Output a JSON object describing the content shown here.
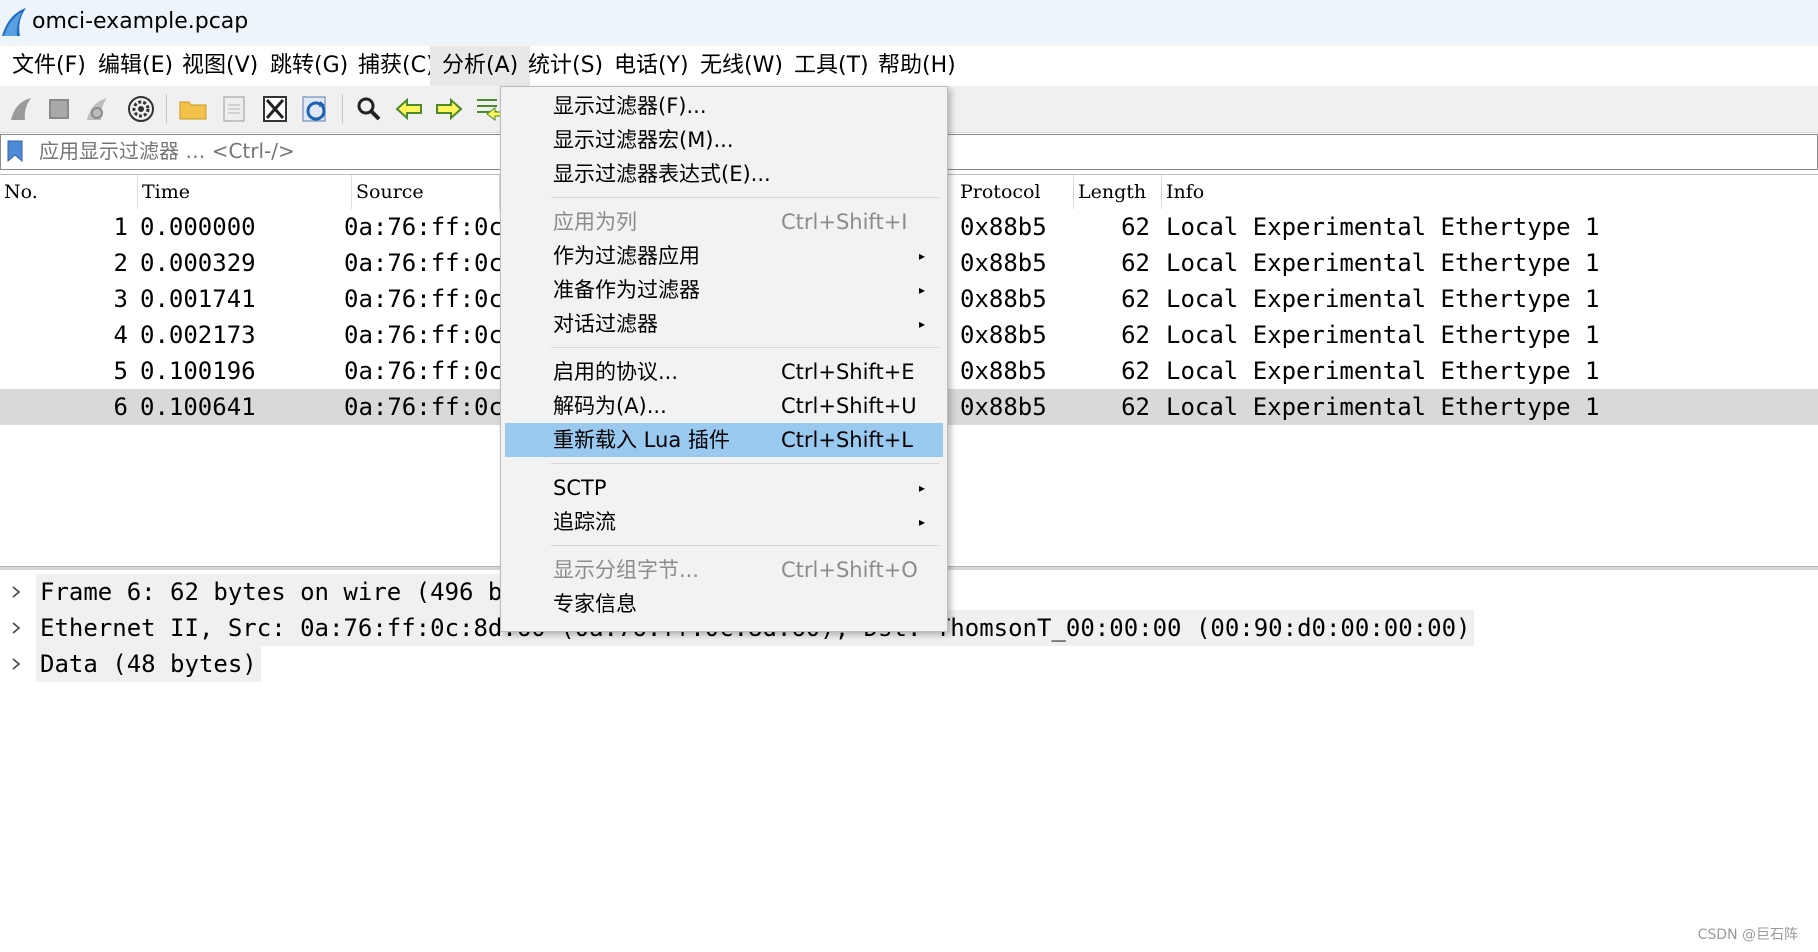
{
  "window": {
    "title": "omci-example.pcap"
  },
  "menubar": {
    "items": [
      {
        "label": "文件(F)"
      },
      {
        "label": "编辑(E)"
      },
      {
        "label": "视图(V)"
      },
      {
        "label": "跳转(G)"
      },
      {
        "label": "捕获(C)"
      },
      {
        "label": "分析(A)"
      },
      {
        "label": "统计(S)"
      },
      {
        "label": "电话(Y)"
      },
      {
        "label": "无线(W)"
      },
      {
        "label": "工具(T)"
      },
      {
        "label": "帮助(H)"
      }
    ],
    "open_menu": "分析(A)"
  },
  "toolbar": {
    "icons": [
      "shark-fin-start-icon",
      "stop-square-icon",
      "shark-fin-restart-icon",
      "gear-options-icon",
      "folder-open-icon",
      "file-save-icon",
      "close-file-icon",
      "reload-icon",
      "search-magnifier-icon",
      "arrow-back-icon",
      "arrow-forward-icon",
      "go-to-packet-icon"
    ]
  },
  "filter": {
    "placeholder": "应用显示过滤器 … <Ctrl-/>"
  },
  "packet_list": {
    "columns": [
      "No.",
      "Time",
      "Source",
      "Protocol",
      "Length",
      "Info"
    ],
    "rows": [
      {
        "no": "1",
        "time": "0.000000",
        "source": "0a:76:ff:0c",
        "protocol": "0x88b5",
        "length": "62",
        "info": "Local Experimental Ethertype 1"
      },
      {
        "no": "2",
        "time": "0.000329",
        "source": "0a:76:ff:0c",
        "protocol": "0x88b5",
        "length": "62",
        "info": "Local Experimental Ethertype 1"
      },
      {
        "no": "3",
        "time": "0.001741",
        "source": "0a:76:ff:0c",
        "protocol": "0x88b5",
        "length": "62",
        "info": "Local Experimental Ethertype 1"
      },
      {
        "no": "4",
        "time": "0.002173",
        "source": "0a:76:ff:0c",
        "protocol": "0x88b5",
        "length": "62",
        "info": "Local Experimental Ethertype 1"
      },
      {
        "no": "5",
        "time": "0.100196",
        "source": "0a:76:ff:0c",
        "protocol": "0x88b5",
        "length": "62",
        "info": "Local Experimental Ethertype 1"
      },
      {
        "no": "6",
        "time": "0.100641",
        "source": "0a:76:ff:0c",
        "protocol": "0x88b5",
        "length": "62",
        "info": "Local Experimental Ethertype 1"
      }
    ],
    "selected_row": "6"
  },
  "details": {
    "rows": [
      {
        "text": "Frame 6: 62 bytes on wire (496 b                              bits)"
      },
      {
        "text": "Ethernet II, Src: 0a:76:ff:0c:8d:60 (0a:76:ff:0c:8d:60), Dst: ThomsonT_00:00:00 (00:90:d0:00:00:00)"
      },
      {
        "text": "Data (48 bytes)"
      }
    ]
  },
  "dropdown": {
    "groups": [
      [
        {
          "label": "显示过滤器(F)...",
          "shortcut": "",
          "submenu": false,
          "disabled": false
        },
        {
          "label": "显示过滤器宏(M)...",
          "shortcut": "",
          "submenu": false,
          "disabled": false
        },
        {
          "label": "显示过滤器表达式(E)...",
          "shortcut": "",
          "submenu": false,
          "disabled": false
        }
      ],
      [
        {
          "label": "应用为列",
          "shortcut": "Ctrl+Shift+I",
          "submenu": false,
          "disabled": true
        },
        {
          "label": "作为过滤器应用",
          "shortcut": "",
          "submenu": true,
          "disabled": false
        },
        {
          "label": "准备作为过滤器",
          "shortcut": "",
          "submenu": true,
          "disabled": false
        },
        {
          "label": "对话过滤器",
          "shortcut": "",
          "submenu": true,
          "disabled": false
        }
      ],
      [
        {
          "label": "启用的协议...",
          "shortcut": "Ctrl+Shift+E",
          "submenu": false,
          "disabled": false
        },
        {
          "label": "解码为(A)...",
          "shortcut": "Ctrl+Shift+U",
          "submenu": false,
          "disabled": false
        },
        {
          "label": "重新载入 Lua 插件",
          "shortcut": "Ctrl+Shift+L",
          "submenu": false,
          "disabled": false,
          "highlighted": true
        }
      ],
      [
        {
          "label": "SCTP",
          "shortcut": "",
          "submenu": true,
          "disabled": false
        },
        {
          "label": "追踪流",
          "shortcut": "",
          "submenu": true,
          "disabled": false
        }
      ],
      [
        {
          "label": "显示分组字节...",
          "shortcut": "Ctrl+Shift+O",
          "submenu": false,
          "disabled": true
        },
        {
          "label": "专家信息",
          "shortcut": "",
          "submenu": false,
          "disabled": false
        }
      ]
    ]
  },
  "watermark": {
    "text": "CSDN @巨石阵"
  },
  "colors": {
    "highlight": "#99c9ef",
    "selected_row": "#d9d9d9",
    "titlebar": "#eef5fa",
    "accent_blue": "#1f6fc4"
  }
}
